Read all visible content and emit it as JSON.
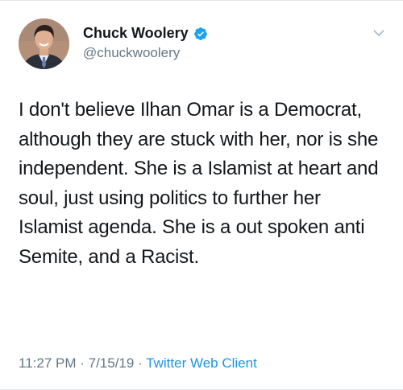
{
  "author": {
    "display_name": "Chuck Woolery",
    "handle": "@chuckwoolery",
    "verified": true,
    "verified_icon": "verified-badge-icon",
    "verified_color": "#1da1f2"
  },
  "tweet": {
    "text": "I don't believe Ilhan Omar is a Democrat, although they are stuck with her, nor is she independent. She is a Islamist at heart and soul, just using politics to further her Islamist agenda. She is a out spoken anti Semite, and a Racist.",
    "time": "11:27 PM",
    "date": "7/15/19",
    "separator": " · ",
    "client": "Twitter Web Client"
  },
  "menu": {
    "icon": "chevron-down-icon"
  },
  "colors": {
    "text": "#14171a",
    "muted": "#657786",
    "link": "#1b95e0"
  }
}
